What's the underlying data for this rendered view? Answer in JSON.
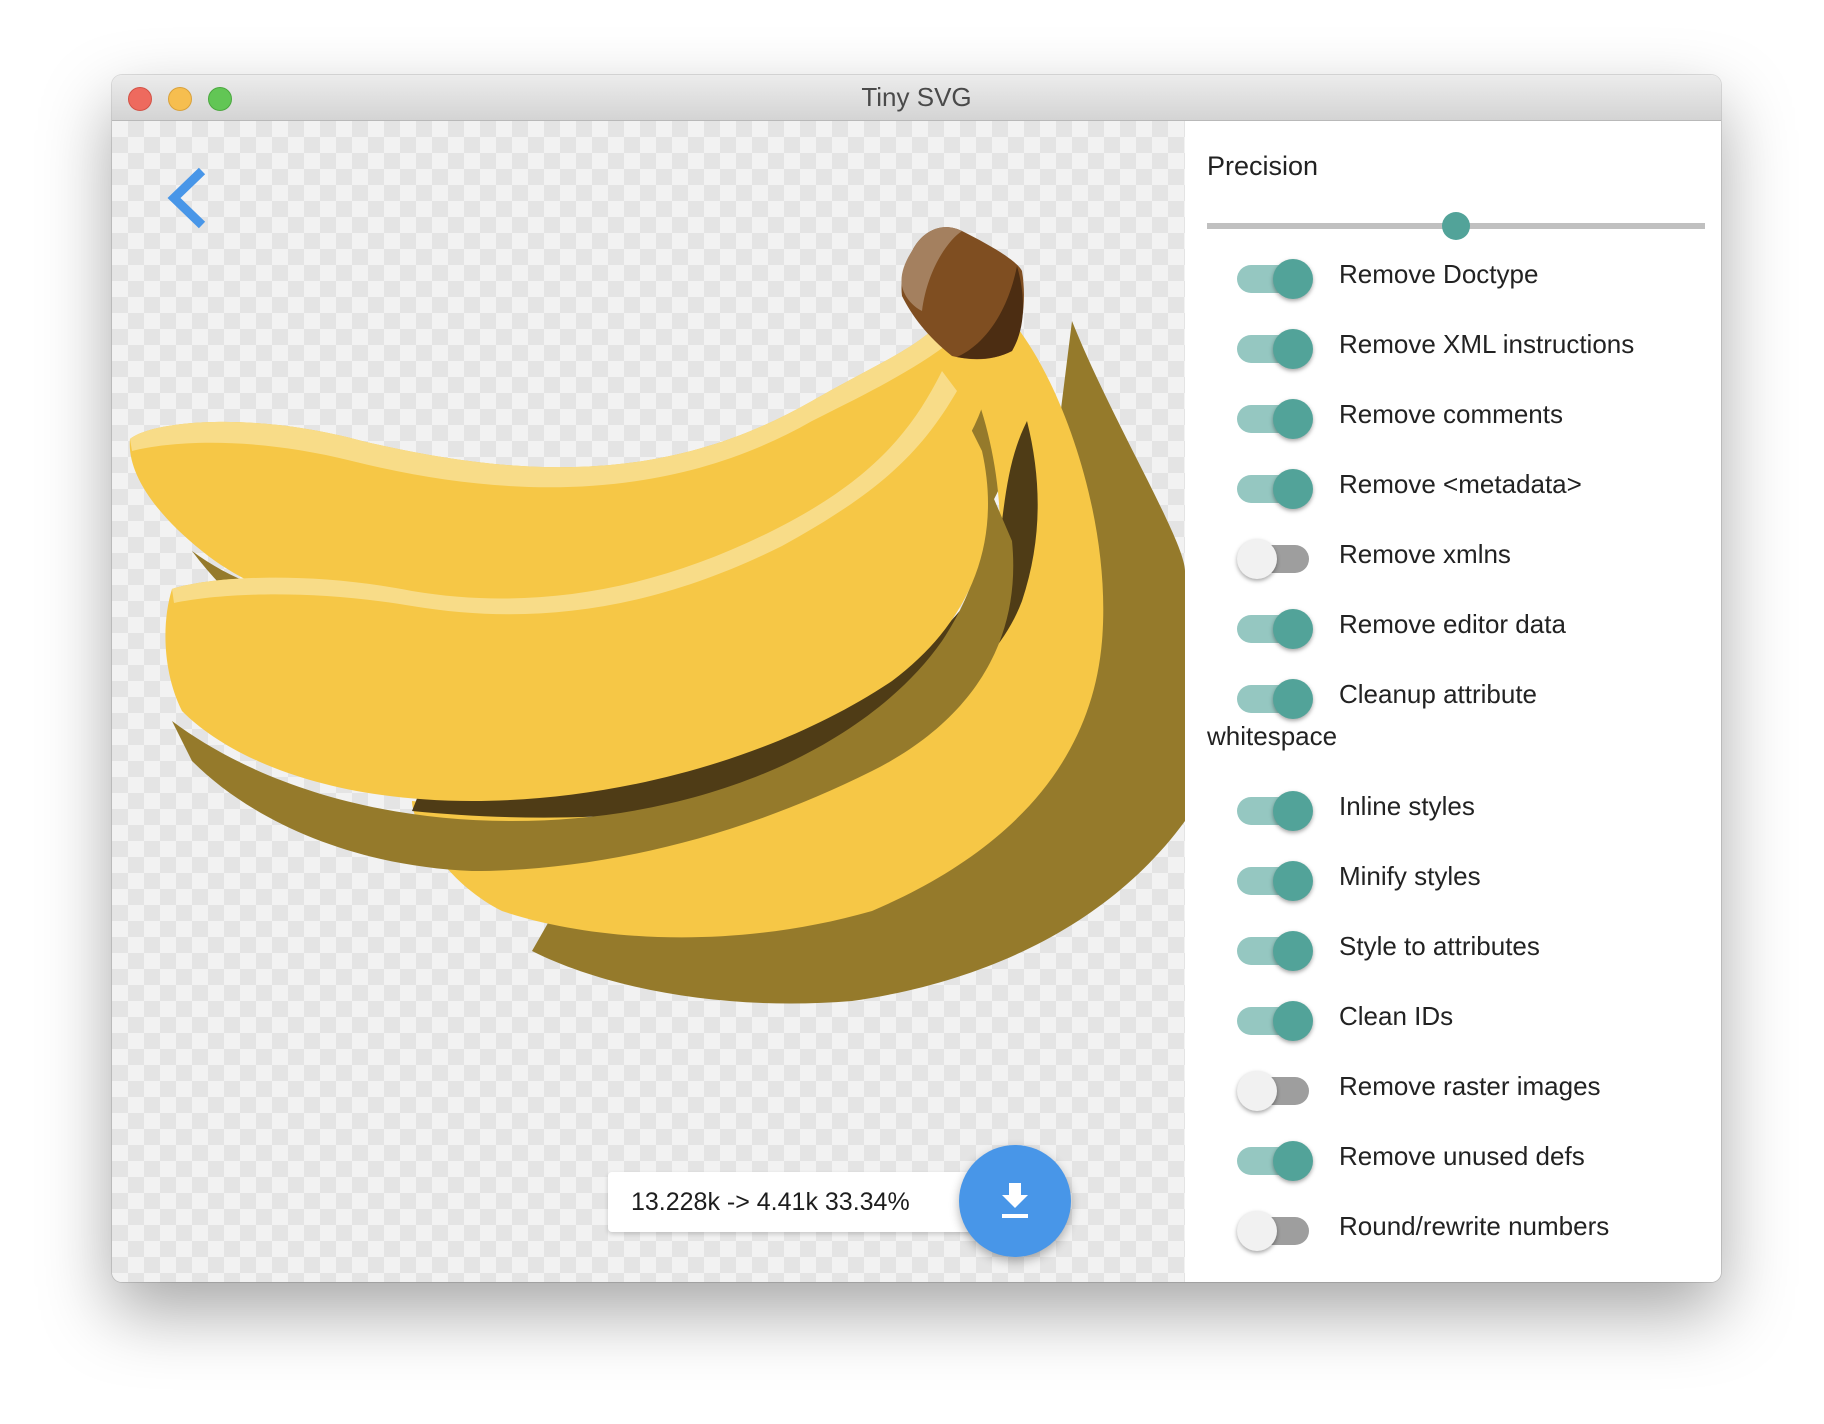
{
  "window": {
    "title": "Tiny SVG",
    "controls": [
      "close",
      "minimize",
      "maximize"
    ]
  },
  "preview": {
    "back_icon": "chevron-left-icon",
    "image_subject": "banana bunch",
    "colors": {
      "banana_yellow": "#f6c746",
      "banana_highlight": "#f8dc88",
      "banana_shadow": "#957a2b",
      "banana_deep_shadow": "#624c1e",
      "stem": "#7f4e21",
      "stem_light": "#a4805f",
      "stem_dark": "#4c2d12"
    },
    "stats": "13.228k -> 4.41k 33.34%",
    "download_icon": "download-icon",
    "accent": "#4896e8"
  },
  "settings": {
    "precision": {
      "label": "Precision",
      "value_fraction": 0.5
    },
    "accent": "#52a399",
    "options": [
      {
        "label": "Remove Doctype",
        "enabled": true
      },
      {
        "label": "Remove XML instructions",
        "enabled": true
      },
      {
        "label": "Remove comments",
        "enabled": true
      },
      {
        "label": "Remove <metadata>",
        "enabled": true
      },
      {
        "label": "Remove xmlns",
        "enabled": false
      },
      {
        "label": "Remove editor data",
        "enabled": true
      },
      {
        "label": "Cleanup attribute",
        "label_wrap": "whitespace",
        "enabled": true
      },
      {
        "label": "Inline styles",
        "enabled": true
      },
      {
        "label": "Minify styles",
        "enabled": true
      },
      {
        "label": "Style to attributes",
        "enabled": true
      },
      {
        "label": "Clean IDs",
        "enabled": true
      },
      {
        "label": "Remove raster images",
        "enabled": false
      },
      {
        "label": "Remove unused defs",
        "enabled": true
      },
      {
        "label": "Round/rewrite numbers",
        "enabled": false
      }
    ]
  }
}
